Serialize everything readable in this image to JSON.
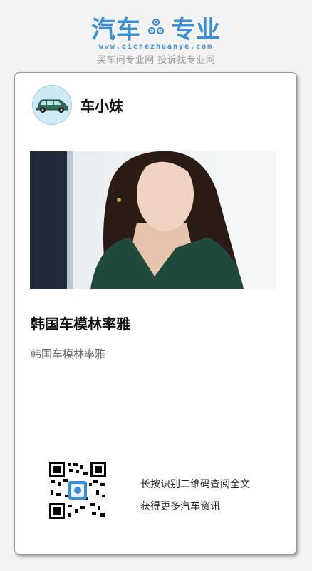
{
  "header": {
    "logo_left": "汽车",
    "logo_right": "专业",
    "logo_url": "www.qichezhuanye.com",
    "slogan": "买车问专业网 投诉找专业网",
    "brand_color": "#3d8fd0"
  },
  "author": {
    "name": "车小妹",
    "avatar_icon": "car-icon"
  },
  "article": {
    "title": "韩国车模林率雅",
    "summary": "韩国车模林率雅"
  },
  "footer": {
    "qr_icon": "qr-code-icon",
    "line1": "长按识别二维码查阅全文",
    "line2": "获得更多汽车资讯"
  }
}
